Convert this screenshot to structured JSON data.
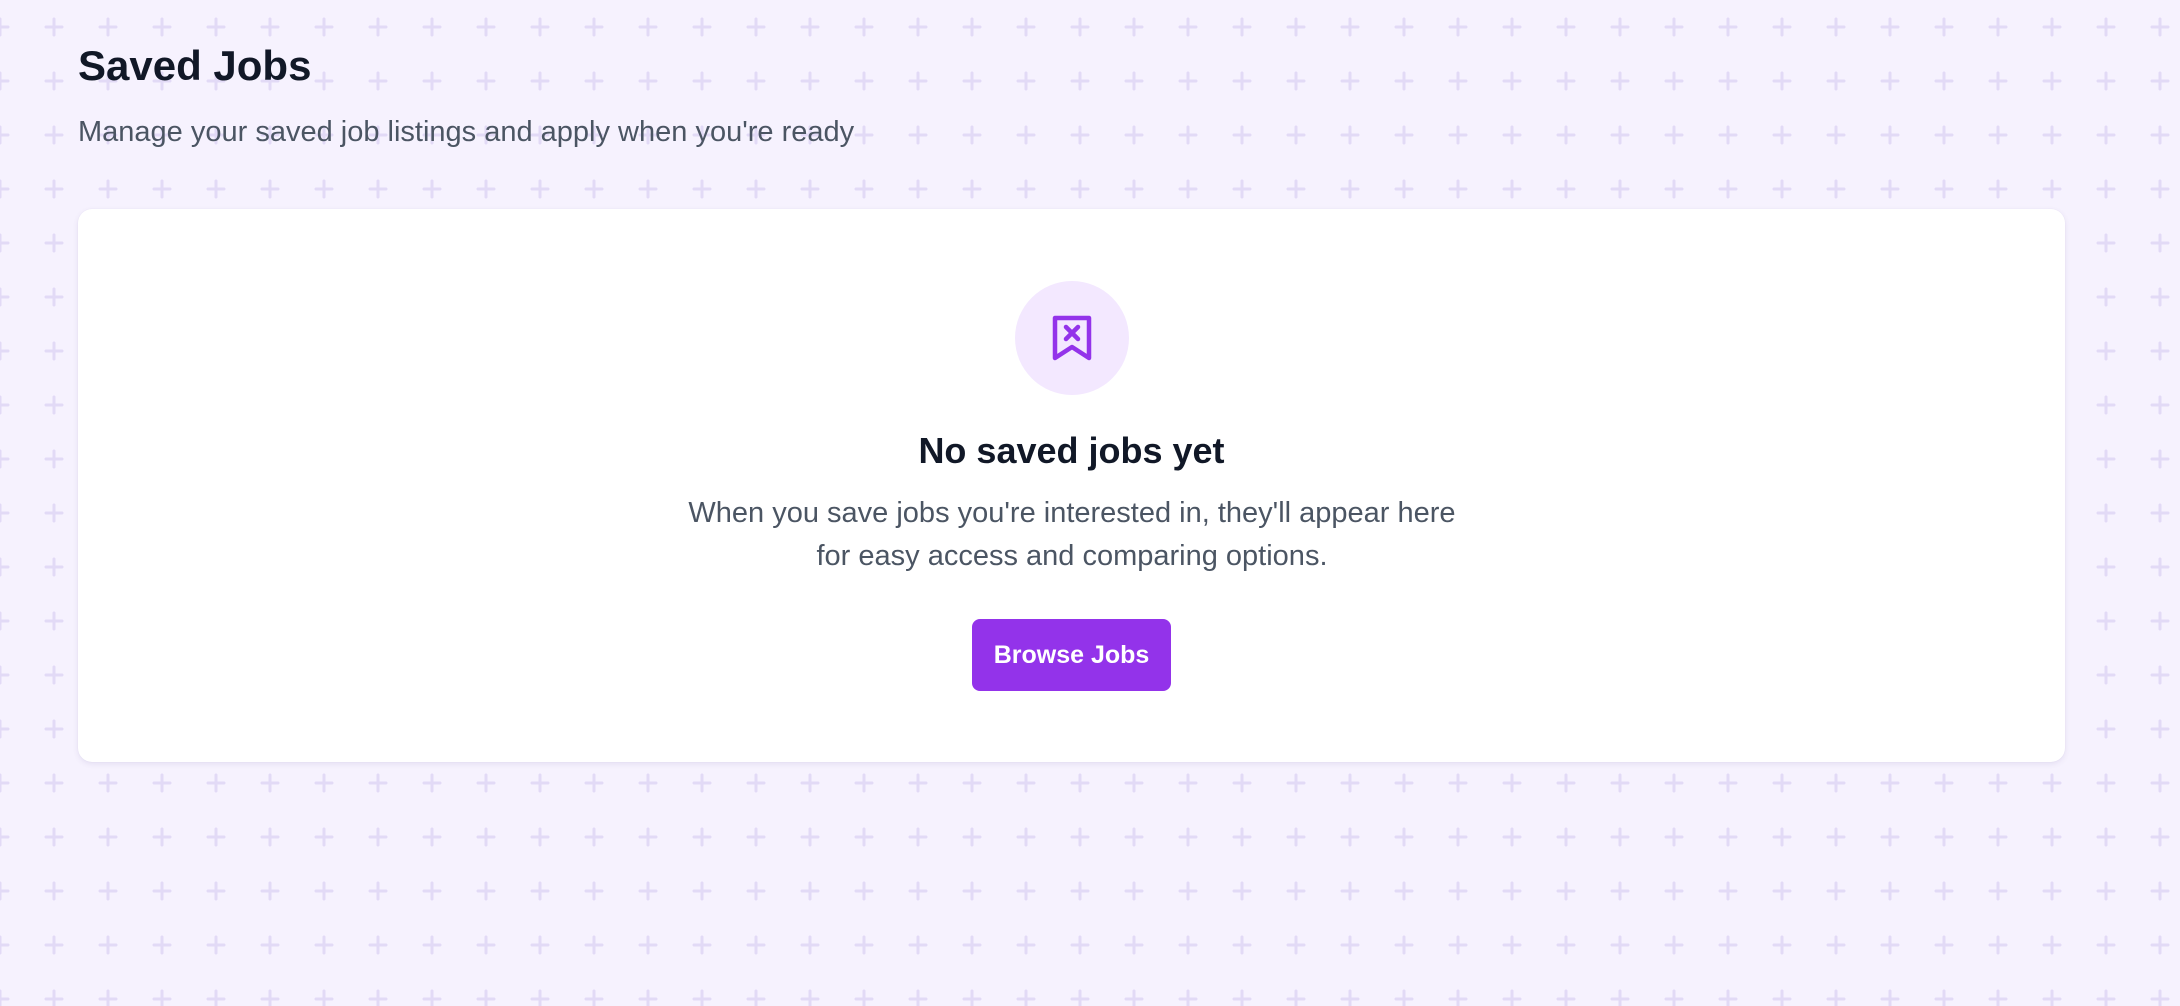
{
  "header": {
    "title": "Saved Jobs",
    "subtitle": "Manage your saved job listings and apply when you're ready"
  },
  "empty_state": {
    "icon": "bookmark-x-icon",
    "title": "No saved jobs yet",
    "message": "When you save jobs you're interested in, they'll appear here for easy access and comparing options.",
    "button_label": "Browse Jobs"
  },
  "colors": {
    "accent": "#9333ea",
    "icon_bg": "#f3e8ff",
    "page_bg": "#f6f2fe",
    "heading": "#111827",
    "body_text": "#4b5563"
  }
}
